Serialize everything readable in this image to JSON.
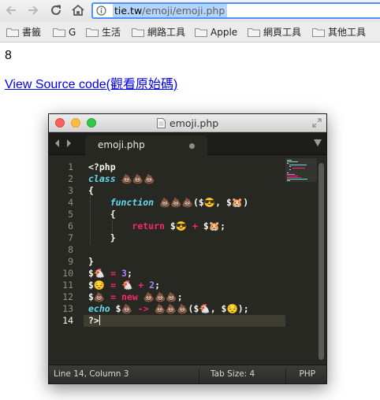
{
  "browser": {
    "url_host": "tie.tw",
    "url_path": "/emoji/emoji.php",
    "nav_icons": [
      "back-arrow-icon",
      "forward-arrow-icon",
      "reload-icon",
      "home-icon",
      "info-icon"
    ]
  },
  "bookmarks": [
    {
      "label": "書籤"
    },
    {
      "label": "G"
    },
    {
      "label": "生活"
    },
    {
      "label": "網路工具"
    },
    {
      "label": "Apple"
    },
    {
      "label": "網頁工具"
    },
    {
      "label": "其他工具"
    }
  ],
  "page": {
    "counter": "8",
    "source_link": "View Source code(觀看原始碼)"
  },
  "editor": {
    "window_title": "emoji.php",
    "tab_label": "emoji.php",
    "line_numbers": [
      "1",
      "2",
      "3",
      "4",
      "5",
      "6",
      "7",
      "8",
      "9",
      "10",
      "11",
      "12",
      "13",
      "14"
    ],
    "active_line": "14",
    "code": {
      "l1": "<?php",
      "l2_kw": "class",
      "l2_rest": " 💩💩💩",
      "l3": "{",
      "l4_kw": "function",
      "l4_rest": " 💩💩💩($😎, $🐹)",
      "l5": "{",
      "l6_kw": "return",
      "l6_a": " $😎 ",
      "l6_op": "+",
      "l6_b": " $🐹;",
      "l7": "}",
      "l8": "",
      "l9": "}",
      "l10_a": "$🐔 ",
      "l10_op": "=",
      "l10_num": " 3",
      "l10_end": ";",
      "l11_a": "$😔 ",
      "l11_op": "=",
      "l11_b": " 🐔 ",
      "l11_op2": "+",
      "l11_num": " 2",
      "l11_end": ";",
      "l12_a": "$💩 ",
      "l12_op": "=",
      "l12_new": " new",
      "l12_b": " 💩💩💩;",
      "l13_kw": "echo",
      "l13_a": " $💩 ",
      "l13_op": "->",
      "l13_b": " 💩💩💩($🐔, $😔);",
      "l14": "?>"
    },
    "status": {
      "position": "Line 14, Column 3",
      "tab_size": "Tab Size: 4",
      "syntax": "PHP"
    }
  },
  "colors": {
    "link": "#0000ee",
    "editor_bg": "#272822",
    "keyword": "#66d9ef",
    "operator": "#f92672",
    "number": "#ae81ff",
    "omnibox_focus": "#4d90fe"
  }
}
